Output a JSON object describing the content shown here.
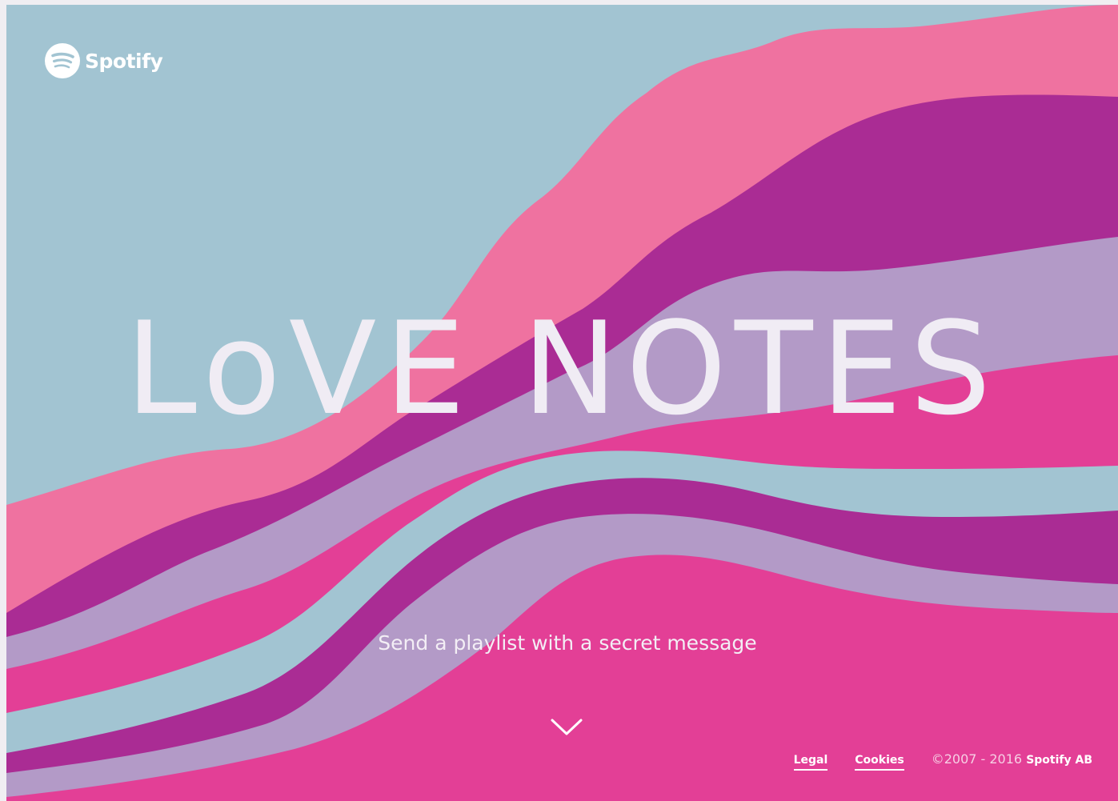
{
  "brand": {
    "name": "Spotify",
    "logo_icon": "spotify-logo-icon"
  },
  "hero": {
    "title": "LoVE NOTES",
    "subtitle": "Send a playlist with a secret message",
    "scroll_icon": "chevron-down-icon"
  },
  "footer": {
    "legal_label": "Legal",
    "cookies_label": "Cookies",
    "copyright_years": "©2007 - 2016",
    "copyright_owner": "Spotify AB"
  },
  "colors": {
    "sky": "#a2c4d2",
    "pink": "#ef72a0",
    "purple": "#aa2c94",
    "lavender": "#b39ac7",
    "magenta": "#e33f96",
    "text": "#f0ecf4"
  }
}
